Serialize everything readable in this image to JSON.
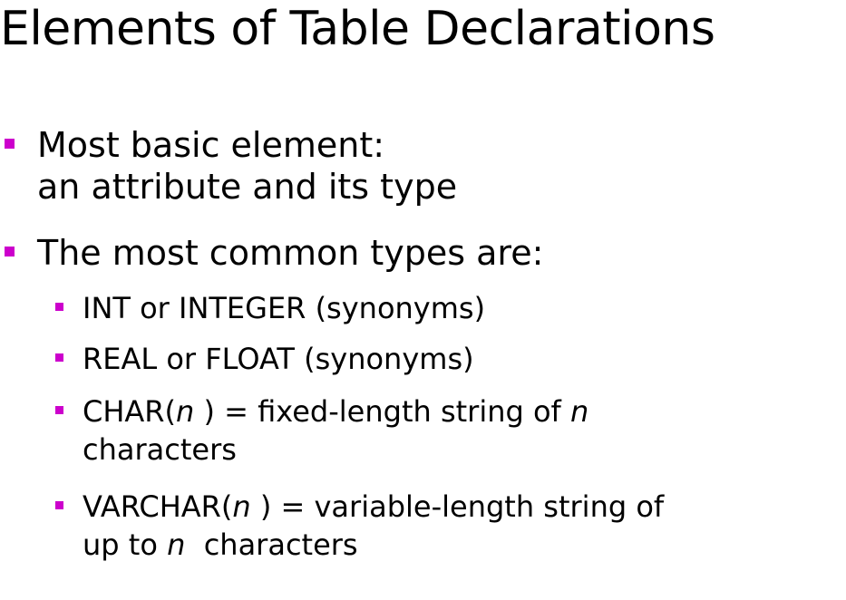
{
  "slide": {
    "title": "Elements of Table Declarations",
    "bullet_color": "#cc00cc",
    "bullets": [
      {
        "line1": "Most basic element:",
        "line2": "an attribute and its type"
      },
      {
        "line1": "The most common types are:",
        "subbullets": [
          {
            "text": "INT or INTEGER (synonyms)"
          },
          {
            "text": "REAL or FLOAT (synonyms)"
          },
          {
            "part1": "CHAR(",
            "var1": "n",
            "part2": " ) = fixed-length string of ",
            "var2": "n",
            "line2": "characters"
          },
          {
            "part1": "VARCHAR(",
            "var1": "n",
            "part2": " ) = variable-length string of",
            "line2_part1": "up to ",
            "line2_var": "n",
            "line2_part2": "  characters"
          }
        ]
      }
    ]
  }
}
